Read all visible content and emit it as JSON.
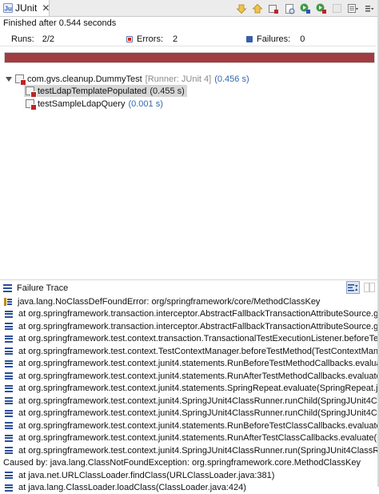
{
  "tab": {
    "title": "JUnit",
    "icon": "junit-icon",
    "close_glyph": "✕"
  },
  "toolbar": {
    "buttons": [
      {
        "name": "next-failure-icon"
      },
      {
        "name": "previous-failure-icon"
      },
      {
        "name": "show-failures-only-icon"
      },
      {
        "name": "scroll-lock-icon"
      },
      {
        "name": "rerun-test-icon"
      },
      {
        "name": "rerun-failed-first-icon"
      },
      {
        "name": "stop-icon"
      },
      {
        "name": "test-run-history-icon"
      },
      {
        "name": "view-menu-icon"
      }
    ]
  },
  "status": {
    "finished": "Finished after 0.544 seconds"
  },
  "counters": {
    "runs_label": "Runs:",
    "runs_value": "2/2",
    "errors_label": "Errors:",
    "errors_value": "2",
    "failures_label": "Failures:",
    "failures_value": "0"
  },
  "progress": {
    "fraction": 1.0,
    "color": "#9f3d42"
  },
  "tree": {
    "suite": {
      "name": "com.gvs.cleanup.DummyTest",
      "runner": "[Runner: JUnit 4]",
      "time": "(0.456 s)"
    },
    "tests": [
      {
        "name": "testLdapTemplatePopulated",
        "time": "(0.455 s)",
        "selected": true
      },
      {
        "name": "testSampleLdapQuery",
        "time": "(0.001 s)",
        "selected": false
      }
    ]
  },
  "failure_trace": {
    "title": "Failure Trace",
    "lines": [
      {
        "icon": "exception",
        "text": "java.lang.NoClassDefFoundError: org/springframework/core/MethodClassKey"
      },
      {
        "icon": "frame",
        "text": "at org.springframework.transaction.interceptor.AbstractFallbackTransactionAttributeSource.getCache"
      },
      {
        "icon": "frame",
        "text": "at org.springframework.transaction.interceptor.AbstractFallbackTransactionAttributeSource.getTransa"
      },
      {
        "icon": "frame",
        "text": "at org.springframework.test.context.transaction.TransactionalTestExecutionListener.beforeTestMetho"
      },
      {
        "icon": "frame",
        "text": "at org.springframework.test.context.TestContextManager.beforeTestMethod(TestContextManager.ja"
      },
      {
        "icon": "frame",
        "text": "at org.springframework.test.context.junit4.statements.RunBeforeTestMethodCallbacks.evaluate(RunB"
      },
      {
        "icon": "frame",
        "text": "at org.springframework.test.context.junit4.statements.RunAfterTestMethodCallbacks.evaluate(RunAf"
      },
      {
        "icon": "frame",
        "text": "at org.springframework.test.context.junit4.statements.SpringRepeat.evaluate(SpringRepeat.java:72)"
      },
      {
        "icon": "frame",
        "text": "at org.springframework.test.context.junit4.SpringJUnit4ClassRunner.runChild(SpringJUnit4ClassRun"
      },
      {
        "icon": "frame",
        "text": "at org.springframework.test.context.junit4.SpringJUnit4ClassRunner.runChild(SpringJUnit4ClassRun"
      },
      {
        "icon": "frame",
        "text": "at org.springframework.test.context.junit4.statements.RunBeforeTestClassCallbacks.evaluate(RunBef"
      },
      {
        "icon": "frame",
        "text": "at org.springframework.test.context.junit4.statements.RunAfterTestClassCallbacks.evaluate(RunAfte"
      },
      {
        "icon": "frame",
        "text": "at org.springframework.test.context.junit4.SpringJUnit4ClassRunner.run(SpringJUnit4ClassRunner.jav"
      },
      {
        "icon": "none",
        "text": "Caused by: java.lang.ClassNotFoundException: org.springframework.core.MethodClassKey"
      },
      {
        "icon": "frame",
        "text": "at java.net.URLClassLoader.findClass(URLClassLoader.java:381)"
      },
      {
        "icon": "frame",
        "text": "at java.lang.ClassLoader.loadClass(ClassLoader.java:424)"
      }
    ]
  },
  "colors": {
    "error_red": "#cc2222",
    "timing_blue": "#3366b0",
    "runner_gray": "#8a8a8a",
    "selection": "#d7d7d7"
  }
}
